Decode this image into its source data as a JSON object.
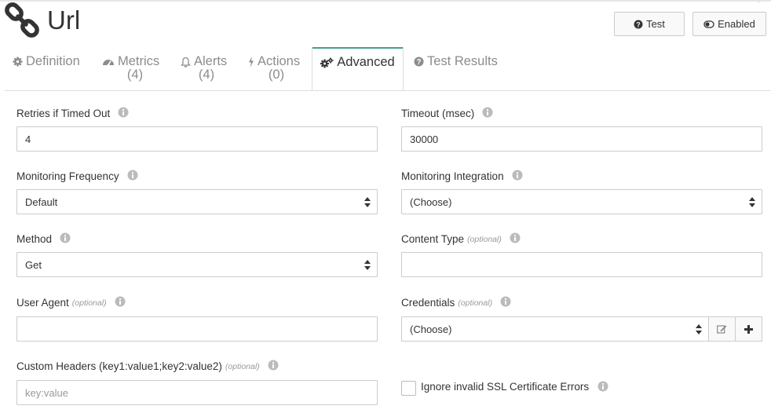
{
  "header": {
    "title": "Url",
    "icon": "link-icon",
    "buttons": {
      "test_label": "Test",
      "test_icon": "question-circle-icon",
      "enabled_label": "Enabled",
      "enabled_icon": "toggle-icon"
    }
  },
  "tabs": [
    {
      "label": "Definition",
      "count": "",
      "icon": "gear-icon",
      "active": false
    },
    {
      "label": "Metrics",
      "count": "(4)",
      "icon": "dashboard-icon",
      "active": false
    },
    {
      "label": "Alerts",
      "count": "(4)",
      "icon": "bell-icon",
      "active": false
    },
    {
      "label": "Actions",
      "count": "(0)",
      "icon": "bolt-icon",
      "active": false
    },
    {
      "label": "Advanced",
      "count": "",
      "icon": "gears-icon",
      "active": true
    },
    {
      "label": "Test Results",
      "count": "",
      "icon": "question-circle-icon",
      "active": false
    }
  ],
  "form": {
    "retries": {
      "label": "Retries if Timed Out",
      "value": "4"
    },
    "timeout": {
      "label": "Timeout (msec)",
      "value": "30000"
    },
    "frequency": {
      "label": "Monitoring Frequency",
      "value": "Default"
    },
    "integration": {
      "label": "Monitoring Integration",
      "value": "(Choose)"
    },
    "method": {
      "label": "Method",
      "value": "Get"
    },
    "content_type": {
      "label": "Content Type",
      "optional": "(optional)",
      "value": ""
    },
    "user_agent": {
      "label": "User Agent",
      "optional": "(optional)",
      "value": ""
    },
    "credentials": {
      "label": "Credentials",
      "optional": "(optional)",
      "value": "(Choose)",
      "edit_icon": "edit-icon",
      "add_icon": "plus-icon"
    },
    "custom_headers": {
      "label": "Custom Headers (key1:value1;key2:value2)",
      "optional": "(optional)",
      "value": "",
      "placeholder": "key:value"
    },
    "ignore_ssl": {
      "label": "Ignore invalid SSL Certificate Errors",
      "checked": false
    }
  },
  "colors": {
    "active_tab_accent": "#4a9d8f",
    "muted_text": "#8c8c8c",
    "border": "#cccccc"
  }
}
